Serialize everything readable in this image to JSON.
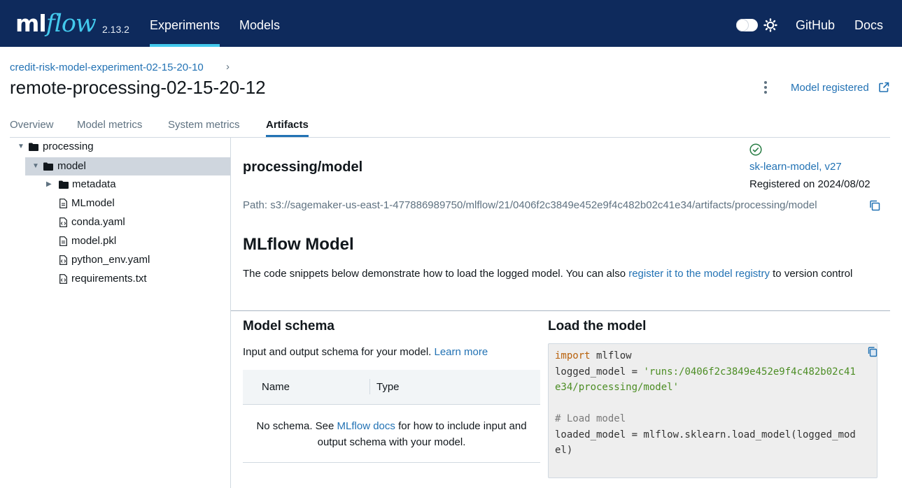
{
  "header": {
    "logo_ml": "ml",
    "logo_flow": "flow",
    "version": "2.13.2",
    "nav": {
      "experiments": "Experiments",
      "models": "Models",
      "github": "GitHub",
      "docs": "Docs"
    },
    "theme_toggle": "sun-icon",
    "accent_color": "#43c9ed",
    "bg_color": "#0e2a5c"
  },
  "breadcrumb": {
    "experiment": "credit-risk-model-experiment-02-15-20-10",
    "separator": "›"
  },
  "run": {
    "title": "remote-processing-02-15-20-12",
    "model_registered_label": "Model registered"
  },
  "tabs": {
    "overview": "Overview",
    "model_metrics": "Model metrics",
    "system_metrics": "System metrics",
    "artifacts": "Artifacts",
    "active": "Artifacts"
  },
  "tree": {
    "items": [
      {
        "label": "processing",
        "type": "folder",
        "expanded": true
      },
      {
        "label": "model",
        "type": "folder",
        "expanded": true,
        "selected": true
      },
      {
        "label": "metadata",
        "type": "folder",
        "expanded": false
      },
      {
        "label": "MLmodel",
        "type": "file"
      },
      {
        "label": "conda.yaml",
        "type": "file"
      },
      {
        "label": "model.pkl",
        "type": "file"
      },
      {
        "label": "python_env.yaml",
        "type": "file"
      },
      {
        "label": "requirements.txt",
        "type": "file"
      }
    ]
  },
  "artifact": {
    "title": "processing/model",
    "registered_model": "sk-learn-model, v27",
    "registered_on": "Registered on 2024/08/02",
    "path": "Path: s3://sagemaker-us-east-1-477886989750/mlflow/21/0406f2c3849e452e9f4c482b02c41e34/artifacts/processing/model"
  },
  "mlflow_model": {
    "title": "MLflow Model",
    "desc_before": "The code snippets below demonstrate how to load the logged model. You can also ",
    "desc_link": "register it to the model registry",
    "desc_after": " to version control"
  },
  "schema": {
    "title": "Model schema",
    "desc": "Input and output schema for your model. ",
    "learn_more": "Learn more",
    "columns": [
      "Name",
      "Type"
    ],
    "empty_before": "No schema. See ",
    "empty_link": "MLflow docs",
    "empty_after": " for how to include input and output schema with your model."
  },
  "load": {
    "title": "Load the model",
    "code": {
      "line1_kw": "import",
      "line1_rest": " mlflow",
      "line2_a": "logged_model = ",
      "line2_str_a": "'runs:/0406f2c3849e452e9f4c482b02c41",
      "line3_str": "e34/processing/model'",
      "line5_comment": "# Load model",
      "line6": "loaded_model = mlflow.sklearn.load_model(logged_mod",
      "line7": "el)"
    }
  }
}
